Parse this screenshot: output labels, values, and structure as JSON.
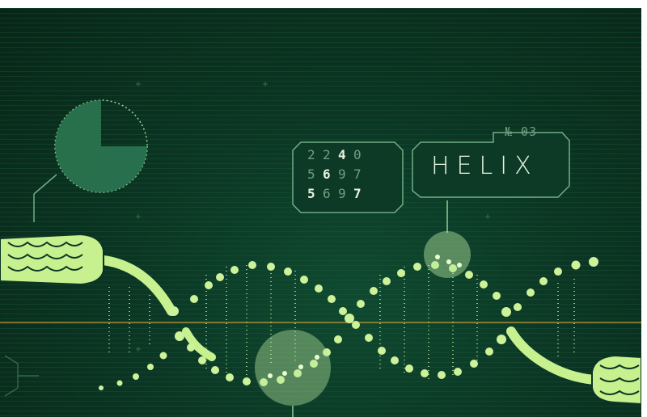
{
  "colors": {
    "background": "#0b3624",
    "accent": "#9fe07a",
    "panel_stroke": "#6fae86",
    "baseline": "#c9a03a"
  },
  "badge": {
    "number": "№ 03",
    "title": "HELIX"
  },
  "number_grid": {
    "rows": [
      [
        "2",
        "2",
        "4",
        "0"
      ],
      [
        "5",
        "6",
        "9",
        "7"
      ],
      [
        "5",
        "6",
        "9",
        "7"
      ]
    ],
    "highlighted": [
      [
        0,
        2
      ],
      [
        1,
        1
      ],
      [
        2,
        0
      ],
      [
        2,
        3
      ]
    ]
  },
  "icons": [
    "pie-chart-icon",
    "wheat-ear-icon",
    "dna-helix-icon",
    "magnifier-lens-icon"
  ]
}
